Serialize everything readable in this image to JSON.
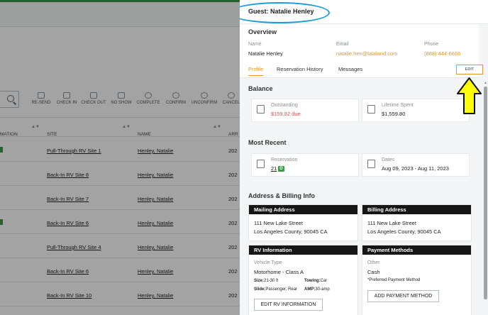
{
  "background": {
    "toolbar": [
      "RE-SEND",
      "CHECK IN",
      "CHECK OUT",
      "NO SHOW",
      "COMPLETE",
      "CONFIRM",
      "UNCONFIRM",
      "CANCEL"
    ],
    "columns": [
      "MATION",
      "SITE",
      "NAME",
      "ARR"
    ],
    "rows": [
      {
        "site": "Pull-Through RV Site 1",
        "name": "Henley, Natalie",
        "year": "202"
      },
      {
        "site": "Back-In RV Site 8",
        "name": "Henley, Natalie",
        "year": "202"
      },
      {
        "site": "Back-In RV Site 7",
        "name": "Henley, Natalie",
        "year": "202"
      },
      {
        "site": "Back-In RV Site 6",
        "name": "Henley, Natalie",
        "year": "202"
      },
      {
        "site": "Pull-Through RV Site 4",
        "name": "Henley, Natalie",
        "year": "202"
      },
      {
        "site": "Back-In RV Site 6",
        "name": "Henley, Natalie",
        "year": "202"
      },
      {
        "site": "Back-In RV Site 10",
        "name": "Henley, Natalie",
        "year": "202"
      }
    ]
  },
  "panel": {
    "title": "Guest: Natalie Henley",
    "overview": {
      "title": "Overview",
      "name_label": "Name",
      "name_value": "Natalie Henley",
      "email_label": "Email",
      "email_value": "natalie.hen@lalaland.com",
      "phone_label": "Phone",
      "phone_value": "(888) 444-6666"
    },
    "tabs": [
      "Profile",
      "Reservation History",
      "Messages"
    ],
    "edit_label": "EDIT",
    "balance": {
      "title": "Balance",
      "outstanding_label": "Outstanding",
      "outstanding_value": "$159.82 due",
      "lifetime_label": "Lifetime Spent",
      "lifetime_value": "$1,559.80"
    },
    "recent": {
      "title": "Most Recent",
      "reservation_label": "Reservation",
      "reservation_value": "21",
      "reservation_badge": "D",
      "dates_label": "Dates",
      "dates_value": "Aug 09, 2023 - Aug 11, 2023"
    },
    "address": {
      "title": "Address & Billing Info",
      "mailing_title": "Mailing Address",
      "mailing_line1": "111 New Lake Street",
      "mailing_line2": "Los Angeles County, 90045 CA",
      "billing_title": "Billing Address",
      "billing_line1": "111 New Lake Street",
      "billing_line2": "Los Angeles County, 90045 CA"
    },
    "rv": {
      "title": "RV Information",
      "type_label": "Vehicle Type",
      "type_value": "Motorhome - Class A",
      "size_label": "Size:",
      "size_value": "21-30 ft",
      "towing_label": "Towing:",
      "towing_value": "Car",
      "slide_label": "Slide:",
      "slide_value": "Passenger, Rear",
      "amp_label": "AMP:",
      "amp_value": "30-amp",
      "edit_button": "EDIT RV INFORMATION"
    },
    "payment": {
      "title": "Payment Methods",
      "other_label": "Other",
      "method": "Cash",
      "preferred": "*Preferred Payment Method",
      "add_button": "ADD PAYMENT METHOD"
    }
  },
  "colors": {
    "accent": "#e0962a",
    "green": "#3c9a48",
    "callout_blue": "#1a9ad6",
    "callout_yellow": "#ffff00",
    "due_red": "#d9534f"
  }
}
